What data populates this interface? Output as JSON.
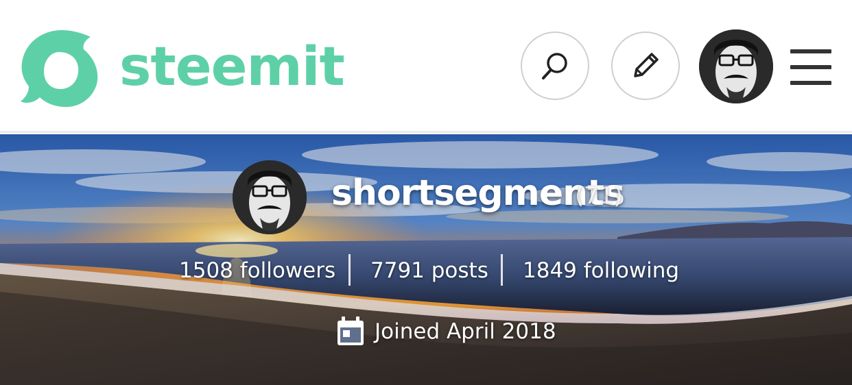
{
  "header": {
    "logo_text": "steemit",
    "brand_color": "#5ed0a7",
    "icons": [
      "steemit-logo-icon",
      "search-icon",
      "pencil-icon",
      "user-avatar",
      "hamburger-menu-icon"
    ]
  },
  "profile": {
    "username": "shortsegments",
    "reputation": "(71)",
    "stats": {
      "followers": "1508 followers",
      "posts": "7791 posts",
      "following": "1849 following"
    },
    "joined": "Joined April 2018",
    "joined_icon": "calendar-icon"
  }
}
